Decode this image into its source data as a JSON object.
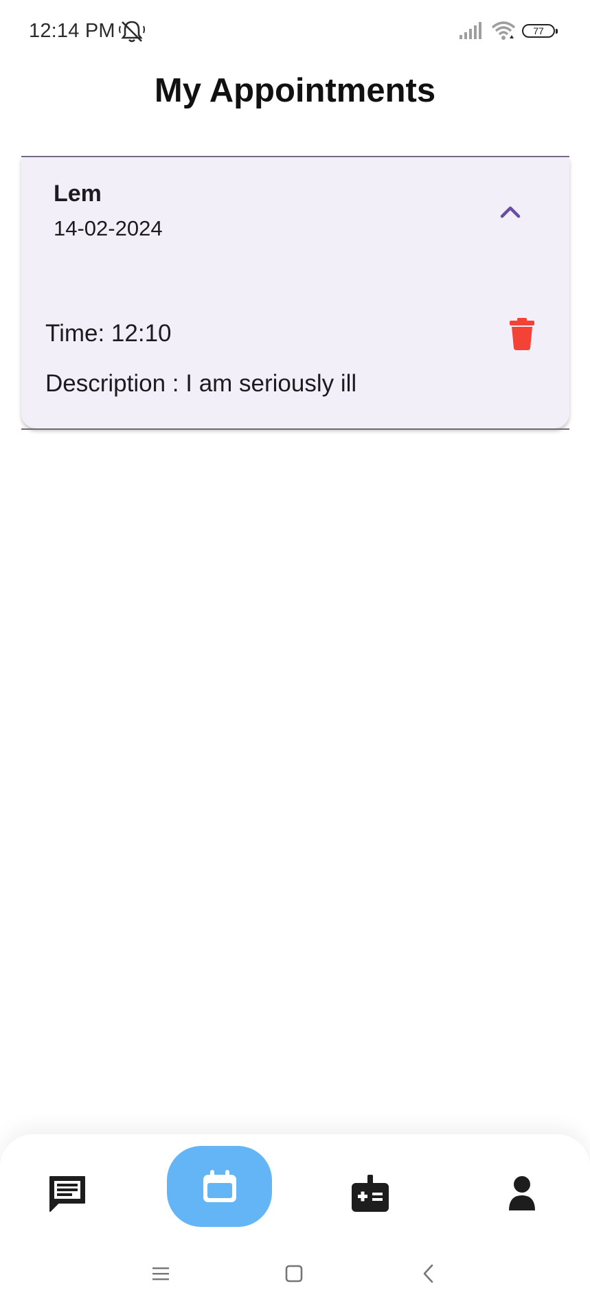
{
  "status_bar": {
    "time": "12:14 PM",
    "battery": "77"
  },
  "header": {
    "title": "My Appointments"
  },
  "appointment": {
    "name": "Lem",
    "date": "14-02-2024",
    "time_text": "Time: 12:10",
    "description_text": "Description : I am seriously ill"
  },
  "colors": {
    "card_bg": "#f3eff8",
    "accent_purple": "#6750a4",
    "delete_red": "#f44336",
    "nav_active_bg": "#63b5f6"
  },
  "bottom_nav": {
    "items": [
      {
        "icon": "chat-icon",
        "active": false
      },
      {
        "icon": "calendar-icon",
        "active": true
      },
      {
        "icon": "medical-kit-icon",
        "active": false
      },
      {
        "icon": "person-icon",
        "active": false
      }
    ]
  }
}
